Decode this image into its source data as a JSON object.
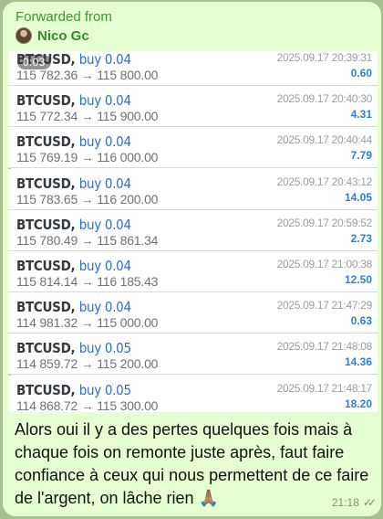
{
  "message": {
    "forwarded_label": "Forwarded from",
    "sender_name": "Nico Gc",
    "media": {
      "video_time": "0:03",
      "trades": [
        {
          "symbol": "BTCUSD,",
          "side": "buy 0.04",
          "prices": "115 782.36 → 115 800.00",
          "time": "2025.09.17 20:39:31",
          "profit": "0.60"
        },
        {
          "symbol": "BTCUSD,",
          "side": "buy 0.04",
          "prices": "115 772.34 → 115 900.00",
          "time": "2025.09.17 20:40:30",
          "profit": "4.31"
        },
        {
          "symbol": "BTCUSD,",
          "side": "buy 0.04",
          "prices": "115 769.19 → 116 000.00",
          "time": "2025.09.17 20:40:44",
          "profit": "7.79"
        },
        {
          "symbol": "BTCUSD,",
          "side": "buy 0.04",
          "prices": "115 783.65 → 116 200.00",
          "time": "2025.09.17 20:43:12",
          "profit": "14.05"
        },
        {
          "symbol": "BTCUSD,",
          "side": "buy 0.04",
          "prices": "115 780.49 → 115 861.34",
          "time": "2025.09.17 20:59:52",
          "profit": "2.73"
        },
        {
          "symbol": "BTCUSD,",
          "side": "buy 0.04",
          "prices": "115 814.14 → 116 185.43",
          "time": "2025.09.17 21:00:38",
          "profit": "12.50"
        },
        {
          "symbol": "BTCUSD,",
          "side": "buy 0.04",
          "prices": "114 981.32 → 115 000.00",
          "time": "2025.09.17 21:47:29",
          "profit": "0.63"
        },
        {
          "symbol": "BTCUSD,",
          "side": "buy 0.05",
          "prices": "114 859.72 → 115 200.00",
          "time": "2025.09.17 21:48:08",
          "profit": "14.36"
        },
        {
          "symbol": "BTCUSD,",
          "side": "buy 0.05",
          "prices": "114 868.72 → 115 300.00",
          "time": "2025.09.17 21:48:17",
          "profit": "18.20"
        }
      ]
    },
    "caption": "Alors oui il y a des pertes quelques fois mais à chaque fois on remonte juste après, faut faire confiance à ceux qui nous permettent de ce faire de l'argent,  on lâche rien 🙏🏽",
    "time": "21:18",
    "status_icon": "double-check-icon",
    "colors": {
      "background": "#a7c08e",
      "bubble": "#e6ffd1",
      "forwarded": "#3a9a33",
      "side": "#2a6fd3",
      "profit": "#2e7fd6"
    }
  }
}
